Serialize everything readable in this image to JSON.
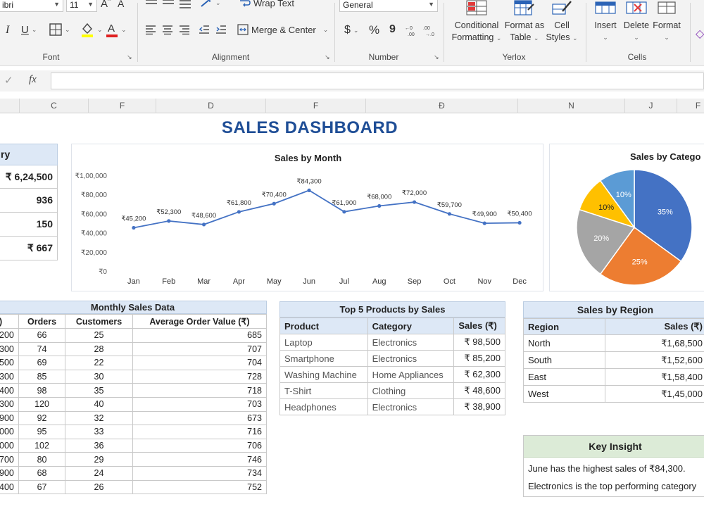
{
  "ribbon": {
    "font_name": "ibri",
    "font_size": "11",
    "wrap_text": "Wrap Text",
    "merge_center": "Merge & Center",
    "number_format": "General",
    "currency_symbol": "$",
    "percent_symbol": "%",
    "comma_symbol": "9",
    "groups": {
      "font": "Font",
      "alignment": "Alignment",
      "number": "Number",
      "styles": "Yerlox",
      "cells": "Cells"
    },
    "conditional_formatting": [
      "Conditional",
      "Formatting"
    ],
    "format_as_table": [
      "Format as",
      "Table"
    ],
    "cell_styles": [
      "Cell",
      "Styles"
    ],
    "insert": "Insert",
    "delete": "Delete",
    "format": "Format",
    "colors": {
      "highlight": "#ffff00",
      "font_color": "#e02020"
    }
  },
  "formula_bar": {
    "fx": "fx",
    "check": "✓",
    "value": ""
  },
  "columns": [
    "C",
    "F",
    "D",
    "F",
    "Đ",
    "N",
    "J",
    "F"
  ],
  "dashboard": {
    "title": "SALES DASHBOARD",
    "summary": {
      "header_fragment": "ry",
      "values": [
        "₹ 6,24,500",
        "936",
        "150",
        "₹ 667"
      ]
    },
    "monthly_table": {
      "title": "Monthly Sales Data",
      "headers": [
        ")",
        "Orders",
        "Customers",
        "Average Order Value (₹)"
      ],
      "rows": [
        [
          "200",
          "66",
          "25",
          "685"
        ],
        [
          "300",
          "74",
          "28",
          "707"
        ],
        [
          "500",
          "69",
          "22",
          "704"
        ],
        [
          "300",
          "85",
          "30",
          "728"
        ],
        [
          "400",
          "98",
          "35",
          "718"
        ],
        [
          "300",
          "120",
          "40",
          "703"
        ],
        [
          "900",
          "92",
          "32",
          "673"
        ],
        [
          "000",
          "95",
          "33",
          "716"
        ],
        [
          "000",
          "102",
          "36",
          "706"
        ],
        [
          "700",
          "80",
          "29",
          "746"
        ],
        [
          "900",
          "68",
          "24",
          "734"
        ],
        [
          "400",
          "67",
          "26",
          "752"
        ]
      ]
    },
    "top_products": {
      "title": "Top 5 Products by Sales",
      "headers": [
        "Product",
        "Category",
        "Sales (₹)"
      ],
      "rows": [
        [
          "Laptop",
          "Electronics",
          "₹ 98,500"
        ],
        [
          "Smartphone",
          "Electronics",
          "₹ 85,200"
        ],
        [
          "Washing Machine",
          "Home Appliances",
          "₹ 62,300"
        ],
        [
          "T-Shirt",
          "Clothing",
          "₹ 48,600"
        ],
        [
          "Headphones",
          "Electronics",
          "₹ 38,900"
        ]
      ]
    },
    "region": {
      "title": "Sales by Region",
      "headers": [
        "Region",
        "Sales (₹)"
      ],
      "rows": [
        [
          "North",
          "₹1,68,500"
        ],
        [
          "South",
          "₹1,52,600"
        ],
        [
          "East",
          "₹1,58,400"
        ],
        [
          "West",
          "₹1,45,000"
        ]
      ]
    },
    "insight": {
      "title": "Key Insight",
      "lines": [
        "June has the highest sales of ₹84,300.",
        "Electronics is the top performing category"
      ]
    }
  },
  "chart_data": [
    {
      "type": "line",
      "title": "Sales by Month",
      "categories": [
        "Jan",
        "Feb",
        "Mar",
        "Apr",
        "May",
        "Jun",
        "Jul",
        "Aug",
        "Sep",
        "Oct",
        "Nov",
        "Dec"
      ],
      "values": [
        45200,
        52300,
        48600,
        61800,
        70400,
        84300,
        61900,
        68000,
        72000,
        59700,
        49900,
        50400
      ],
      "value_labels": [
        "₹45,200",
        "₹52,300",
        "₹48,600",
        "₹61,800",
        "₹70,400",
        "₹84,300",
        "₹61,900",
        "₹68,000",
        "₹72,000",
        "₹59,700",
        "₹49,900",
        "₹50,400"
      ],
      "ytick_values": [
        0,
        20000,
        40000,
        60000,
        80000,
        100000
      ],
      "ytick_labels": [
        "₹0",
        "₹20,000",
        "₹40,000",
        "₹60,000",
        "₹80,000",
        "₹1,00,000"
      ],
      "ylim": [
        0,
        100000
      ],
      "color": "#4472c4",
      "grid": false
    },
    {
      "type": "pie",
      "title": "Sales by Catego",
      "values": [
        35,
        25,
        20,
        10,
        10
      ],
      "labels": [
        "35%",
        "25%",
        "20%",
        "10%",
        "10%"
      ],
      "colors": [
        "#4472c4",
        "#ed7d31",
        "#a5a5a5",
        "#ffc000",
        "#5b9bd5"
      ]
    }
  ]
}
